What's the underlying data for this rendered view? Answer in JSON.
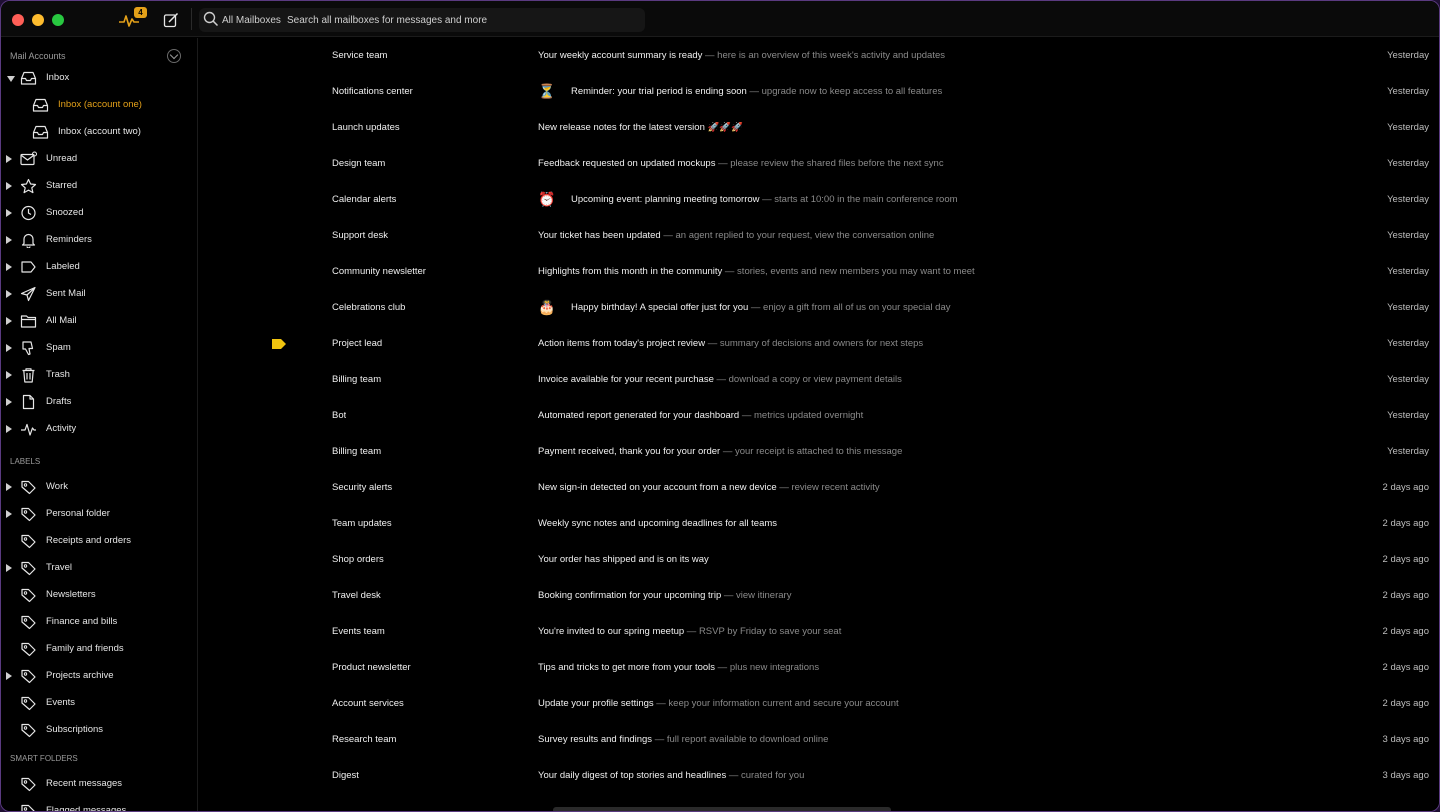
{
  "titlebar": {
    "activity_badge": "4",
    "search_scope": "All Mailboxes",
    "search_placeholder": "Search all mailboxes for messages and more"
  },
  "sidebar": {
    "account_header": "Mail Accounts",
    "items": [
      {
        "label": "Inbox",
        "icon": "inbox-icon",
        "open": true
      },
      {
        "label": "Inbox (account one)",
        "icon": "inbox-icon",
        "child": true,
        "selected": true
      },
      {
        "label": "Inbox (account two)",
        "icon": "inbox-icon",
        "child": true
      },
      {
        "label": "Unread",
        "icon": "envelope-badge-icon"
      },
      {
        "label": "Starred",
        "icon": "star-icon"
      },
      {
        "label": "Snoozed",
        "icon": "clock-icon"
      },
      {
        "label": "Reminders",
        "icon": "bell-icon"
      },
      {
        "label": "Labeled",
        "icon": "label-icon"
      },
      {
        "label": "Sent Mail",
        "icon": "send-icon"
      },
      {
        "label": "All Mail",
        "icon": "folder-icon"
      },
      {
        "label": "Spam",
        "icon": "thumbs-down-icon"
      },
      {
        "label": "Trash",
        "icon": "trash-icon"
      },
      {
        "label": "Drafts",
        "icon": "document-icon"
      },
      {
        "label": "Activity",
        "icon": "activity-icon"
      }
    ],
    "labels_header": "LABELS",
    "labels": [
      {
        "label": "Work",
        "disclosure": true
      },
      {
        "label": "Personal folder",
        "disclosure": true
      },
      {
        "label": "Receipts and orders",
        "disclosure": false
      },
      {
        "label": "Travel",
        "disclosure": true
      },
      {
        "label": "Newsletters",
        "disclosure": false
      },
      {
        "label": "Finance and bills",
        "disclosure": false
      },
      {
        "label": "Family and friends",
        "disclosure": false
      },
      {
        "label": "Projects archive",
        "disclosure": true
      },
      {
        "label": "Events",
        "disclosure": false
      },
      {
        "label": "Subscriptions",
        "disclosure": false
      }
    ],
    "smart_header": "SMART FOLDERS",
    "smart": [
      {
        "label": "Recent messages"
      },
      {
        "label": "Flagged messages"
      }
    ]
  },
  "messages": [
    {
      "sender": "Service team",
      "emoji": "",
      "subject": "Your weekly account summary is ready",
      "preview": " — here is an overview of this week's activity and updates",
      "date": "Yesterday"
    },
    {
      "sender": "Notifications center",
      "emoji": "⏳",
      "subject": "Reminder: your trial period is ending soon",
      "preview": " — upgrade now to keep access to all features",
      "date": "Yesterday"
    },
    {
      "sender": "Launch updates",
      "emoji": "",
      "subject": "New release notes for the latest version",
      "preview": " 🚀🚀🚀",
      "date": "Yesterday"
    },
    {
      "sender": "Design team",
      "emoji": "",
      "subject": "Feedback requested on updated mockups",
      "preview": " — please review the shared files before the next sync",
      "date": "Yesterday"
    },
    {
      "sender": "Calendar alerts",
      "emoji": "⏰",
      "subject": "Upcoming event: planning meeting tomorrow",
      "preview": " — starts at 10:00 in the main conference room",
      "date": "Yesterday"
    },
    {
      "sender": "Support desk",
      "emoji": "",
      "subject": "Your ticket has been updated",
      "preview": " — an agent replied to your request, view the conversation online",
      "date": "Yesterday"
    },
    {
      "sender": "Community newsletter",
      "emoji": "",
      "subject": "Highlights from this month in the community",
      "preview": " — stories, events and new members you may want to meet",
      "date": "Yesterday"
    },
    {
      "sender": "Celebrations club",
      "emoji": "🎂",
      "subject": "Happy birthday! A special offer just for you",
      "preview": " — enjoy a gift from all of us on your special day",
      "date": "Yesterday"
    },
    {
      "sender": "Project lead",
      "emoji": "",
      "subject": "Action items from today's project review",
      "preview": " — summary of decisions and owners for next steps",
      "date": "Yesterday",
      "flag": true
    },
    {
      "sender": "Billing team",
      "emoji": "",
      "subject": "Invoice available for your recent purchase",
      "preview": " — download a copy or view payment details",
      "date": "Yesterday"
    },
    {
      "sender": "Bot",
      "emoji": "",
      "subject": "Automated report generated for your dashboard",
      "preview": " — metrics updated overnight",
      "date": "Yesterday"
    },
    {
      "sender": "Billing team",
      "emoji": "",
      "subject": "Payment received, thank you for your order",
      "preview": " — your receipt is attached to this message",
      "date": "Yesterday"
    },
    {
      "sender": "Security alerts",
      "emoji": "",
      "subject": "New sign-in detected on your account from a new device",
      "preview": " — review recent activity",
      "date": "2 days ago"
    },
    {
      "sender": "Team updates",
      "emoji": "",
      "subject": "Weekly sync notes and upcoming deadlines for all teams",
      "preview": "",
      "date": "2 days ago"
    },
    {
      "sender": "Shop orders",
      "emoji": "",
      "subject": "Your order has shipped and is on its way",
      "preview": "",
      "date": "2 days ago"
    },
    {
      "sender": "Travel desk",
      "emoji": "",
      "subject": "Booking confirmation for your upcoming trip",
      "preview": " — view itinerary",
      "date": "2 days ago"
    },
    {
      "sender": "Events team",
      "emoji": "",
      "subject": "You're invited to our spring meetup",
      "preview": " — RSVP by Friday to save your seat",
      "date": "2 days ago"
    },
    {
      "sender": "Product newsletter",
      "emoji": "",
      "subject": "Tips and tricks to get more from your tools",
      "preview": " — plus new integrations",
      "date": "2 days ago"
    },
    {
      "sender": "Account services",
      "emoji": "",
      "subject": "Update your profile settings",
      "preview": " — keep your information current and secure your account",
      "date": "2 days ago"
    },
    {
      "sender": "Research team",
      "emoji": "",
      "subject": "Survey results and findings",
      "preview": " — full report available to download online",
      "date": "3 days ago"
    },
    {
      "sender": "Digest",
      "emoji": "",
      "subject": "Your daily digest of top stories and headlines",
      "preview": " — curated for you",
      "date": "3 days ago"
    }
  ]
}
